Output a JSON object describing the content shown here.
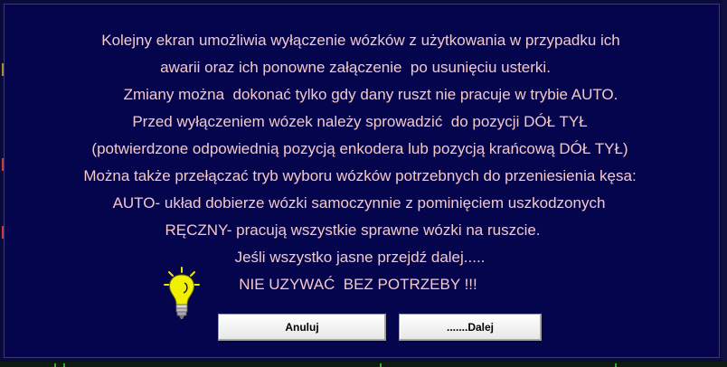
{
  "dialog": {
    "lines": [
      "Kolejny ekran umożliwia wyłączenie wózków z użytkowania w przypadku ich",
      "awarii oraz ich ponowne załączenie  po usunięciu usterki.",
      "Zmiany można  dokonać tylko gdy dany ruszt nie pracuje w trybie AUTO.",
      "Przed wyłączeniem wózek należy sprowadzić  do pozycji DÓŁ TYŁ",
      "(potwierdzone odpowiednią pozycją enkodera lub pozycją krańcową DÓŁ TYŁ)",
      "Można także przełączać tryb wyboru wózków potrzebnych do przeniesienia kęsa:",
      "AUTO- układ dobierze wózki samoczynnie z pominięciem uszkodzonych",
      "RĘCZNY- pracują wszystkie sprawne wózki na ruszcie.",
      "Jeśli wszystko jasne przejdź dalej.....",
      "NIE UZYWAĆ  BEZ POTRZEBY !!!"
    ],
    "cancel_label": "Anuluj",
    "next_label": ".......Dalej",
    "text_color": "#f4c8c8",
    "background_color": "#05054d",
    "icon": "lightbulb-icon"
  }
}
